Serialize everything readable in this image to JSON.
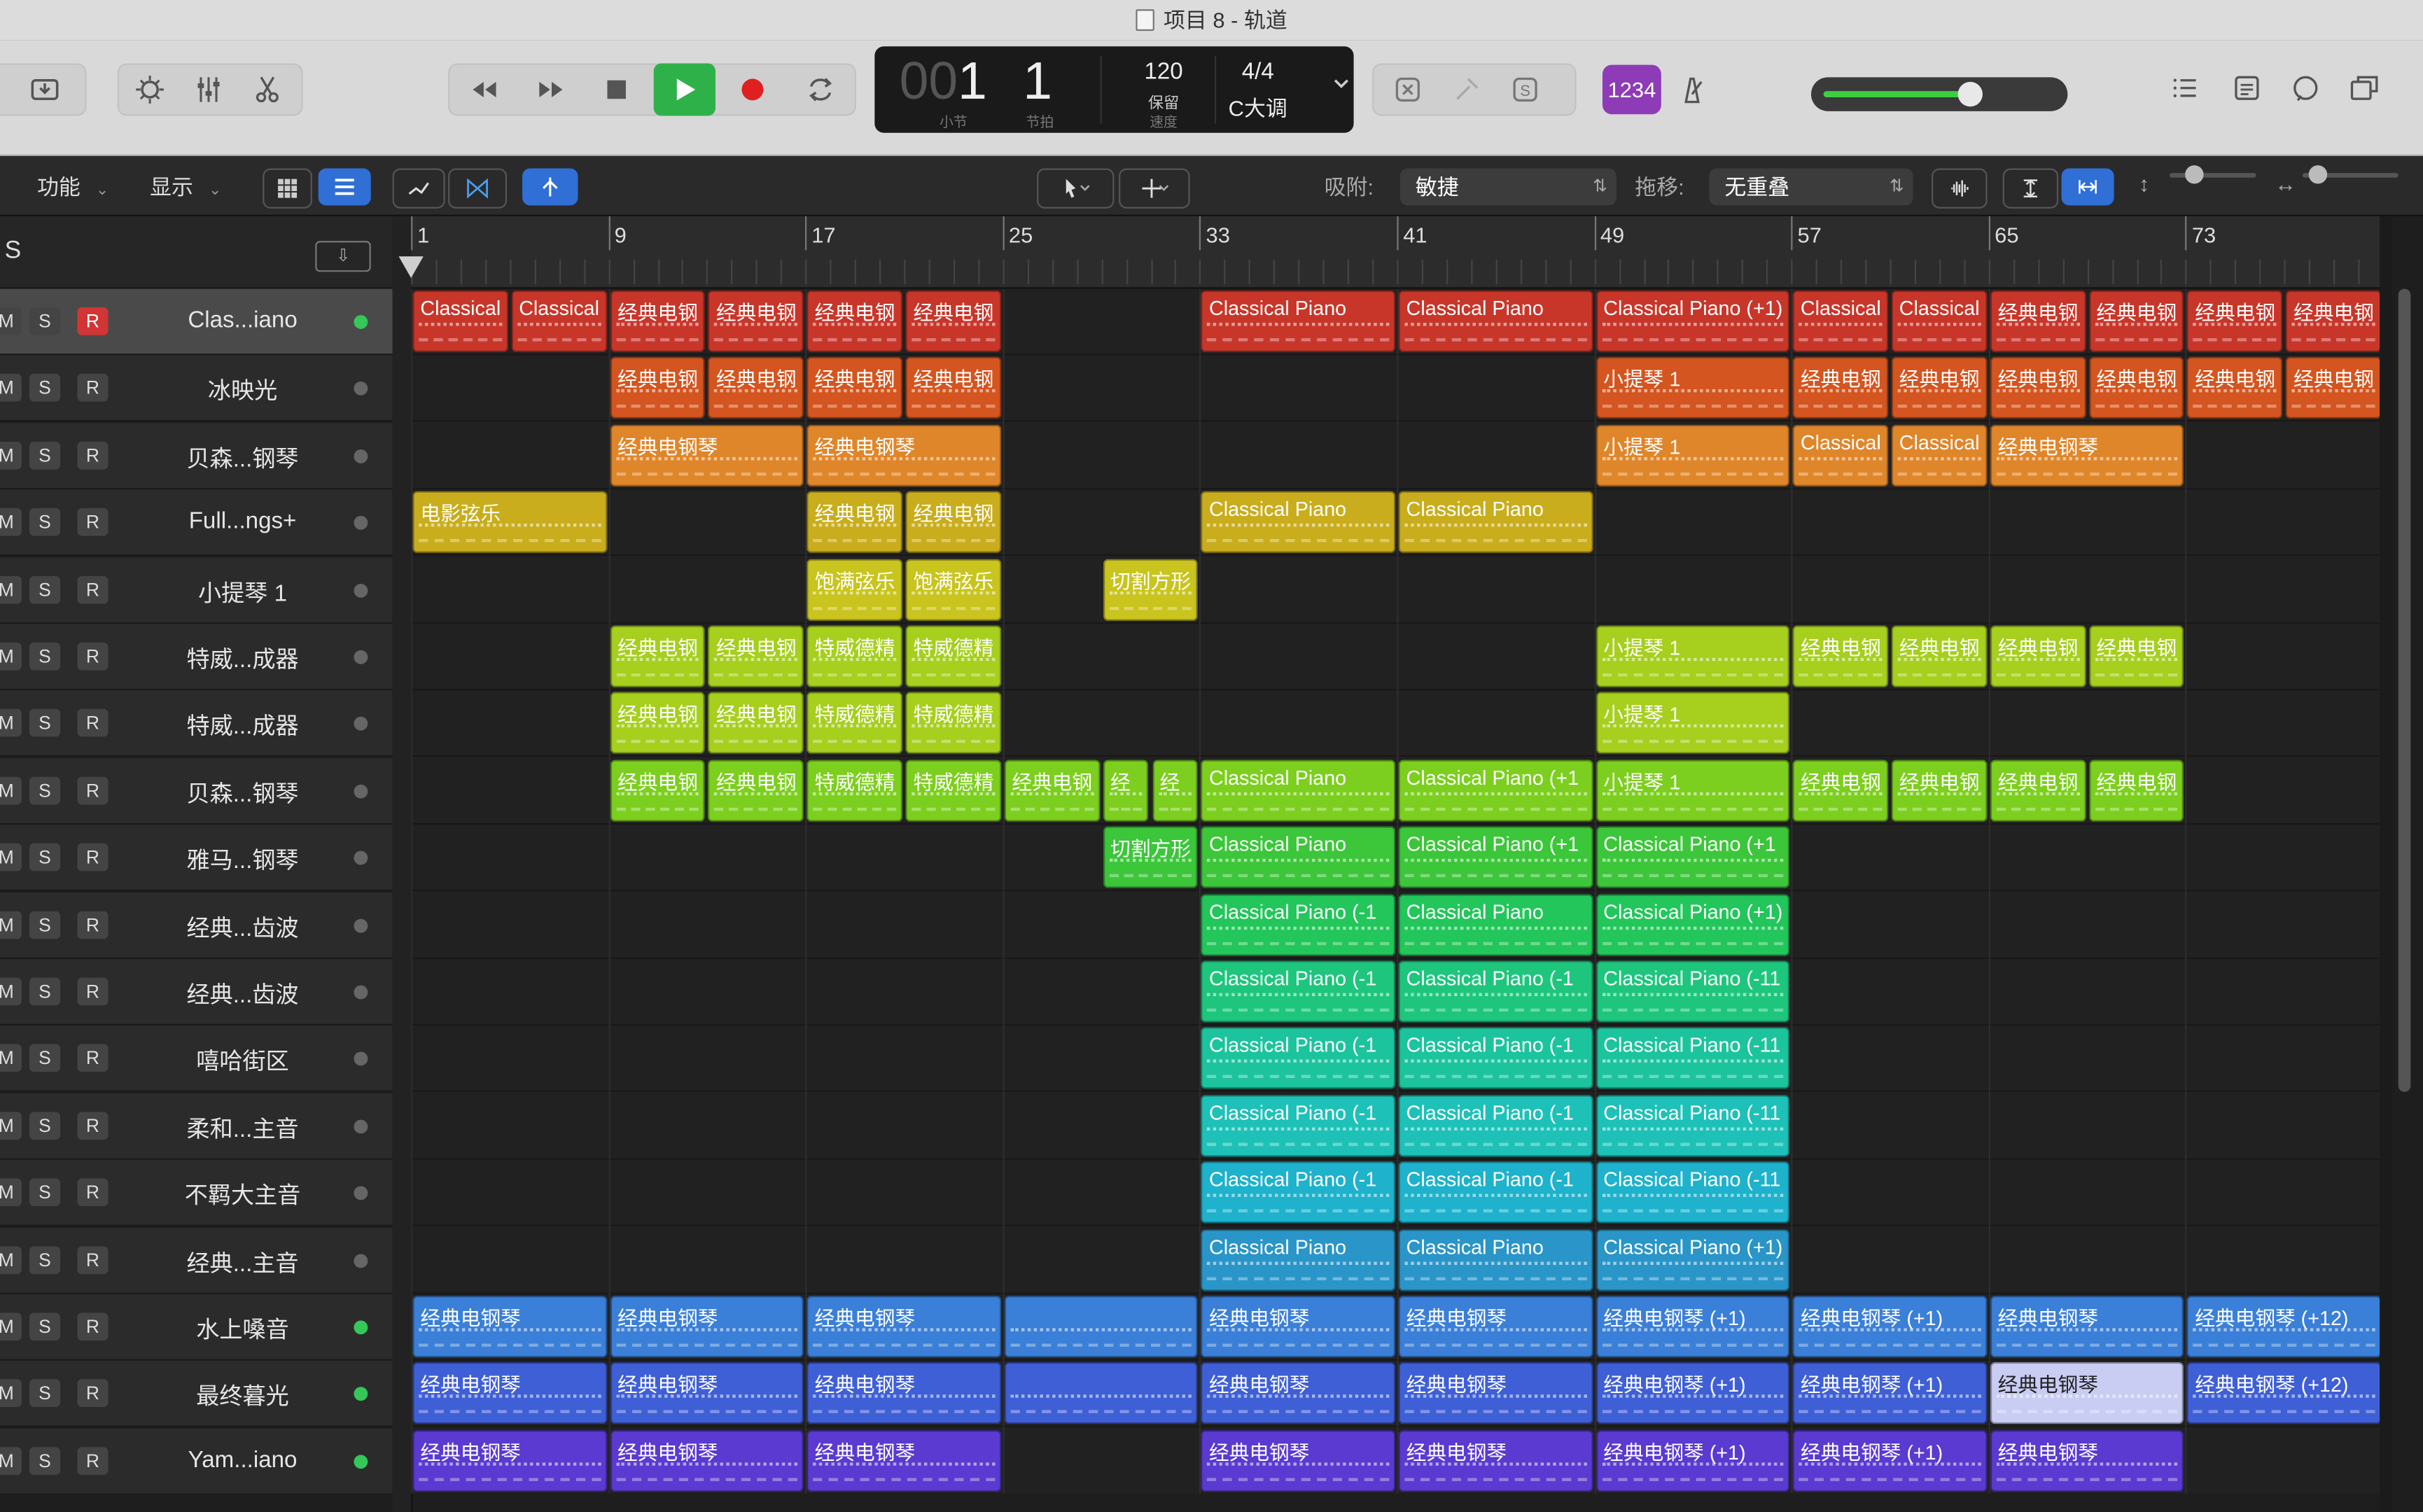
{
  "window": {
    "title": "项目 8 - 轨道"
  },
  "colors": {
    "accent_blue": "#2f6fd6",
    "play_green": "#2fb14a",
    "record_red": "#e02020",
    "count_in": "#8e3bb8"
  },
  "toolbar": {
    "left_icons": [
      "library-icon",
      "smart-controls-icon",
      "mixer-icon",
      "editor-icon"
    ],
    "transport": [
      "rewind-icon",
      "forward-icon",
      "stop-icon",
      "play-icon",
      "record-icon",
      "cycle-icon"
    ],
    "right_icons": [
      "list-editors-icon",
      "notes-icon",
      "loops-icon",
      "browser-icon"
    ]
  },
  "lcd": {
    "bar_dim": "00",
    "bar": "1",
    "beat": "1",
    "bar_label": "小节",
    "beat_label": "节拍",
    "tempo": "120",
    "tempo_mode": "保留",
    "tempo_label": "速度",
    "signature": "4/4",
    "key": "C大调"
  },
  "count_in": {
    "label": "1234"
  },
  "master_volume": {
    "level": 0.62
  },
  "subbar": {
    "menu_function": "功能",
    "menu_display": "显示",
    "snap_label": "吸附:",
    "snap_value": "敏捷",
    "drag_label": "拖移:",
    "drag_value": "无重叠"
  },
  "track_header": {
    "s_label": "S"
  },
  "tracks": [
    {
      "name": "Clas...iano",
      "armed": true,
      "led": true
    },
    {
      "name": "冰映光",
      "armed": false,
      "led": false
    },
    {
      "name": "贝森...钢琴",
      "armed": false,
      "led": false
    },
    {
      "name": "Full...ngs+",
      "armed": false,
      "led": false
    },
    {
      "name": "小提琴 1",
      "armed": false,
      "led": false
    },
    {
      "name": "特威...成器",
      "armed": false,
      "led": false
    },
    {
      "name": "特威...成器",
      "armed": false,
      "led": false
    },
    {
      "name": "贝森...钢琴",
      "armed": false,
      "led": false
    },
    {
      "name": "雅马...钢琴",
      "armed": false,
      "led": false
    },
    {
      "name": "经典...齿波",
      "armed": false,
      "led": false
    },
    {
      "name": "经典...齿波",
      "armed": false,
      "led": false
    },
    {
      "name": "嘻哈街区",
      "armed": false,
      "led": false
    },
    {
      "name": "柔和...主音",
      "armed": false,
      "led": false
    },
    {
      "name": "不羁大主音",
      "armed": false,
      "led": false
    },
    {
      "name": "经典...主音",
      "armed": false,
      "led": false
    },
    {
      "name": "水上嗓音",
      "armed": false,
      "led": true
    },
    {
      "name": "最终暮光",
      "armed": false,
      "led": true
    },
    {
      "name": "Yam...iano",
      "armed": false,
      "led": true
    }
  ],
  "track_buttons": {
    "mute": "M",
    "solo": "S",
    "rec": "R"
  },
  "ruler": {
    "bars": [
      "1",
      "9",
      "17",
      "25",
      "33",
      "41",
      "49",
      "57",
      "65",
      "73"
    ]
  },
  "regions": [
    {
      "track": 0,
      "start": 1,
      "end": 5,
      "label": "Classical",
      "color": "#c8362a"
    },
    {
      "track": 0,
      "start": 5,
      "end": 9,
      "label": "Classical",
      "color": "#c8362a"
    },
    {
      "track": 0,
      "start": 9,
      "end": 13,
      "label": "经典电钢",
      "color": "#c8362a"
    },
    {
      "track": 0,
      "start": 13,
      "end": 17,
      "label": "经典电钢",
      "color": "#c8362a"
    },
    {
      "track": 0,
      "start": 17,
      "end": 21,
      "label": "经典电钢",
      "color": "#c8362a"
    },
    {
      "track": 0,
      "start": 21,
      "end": 25,
      "label": "经典电钢",
      "color": "#c8362a"
    },
    {
      "track": 0,
      "start": 33,
      "end": 41,
      "label": "Classical Piano",
      "color": "#c8362a"
    },
    {
      "track": 0,
      "start": 41,
      "end": 49,
      "label": "Classical Piano",
      "color": "#c8362a"
    },
    {
      "track": 0,
      "start": 49,
      "end": 57,
      "label": "Classical Piano (+1)",
      "color": "#c8362a"
    },
    {
      "track": 0,
      "start": 57,
      "end": 61,
      "label": "Classical",
      "color": "#c8362a"
    },
    {
      "track": 0,
      "start": 61,
      "end": 65,
      "label": "Classical",
      "color": "#c8362a"
    },
    {
      "track": 0,
      "start": 65,
      "end": 69,
      "label": "经典电钢",
      "color": "#c8362a"
    },
    {
      "track": 0,
      "start": 69,
      "end": 73,
      "label": "经典电钢",
      "color": "#c8362a"
    },
    {
      "track": 0,
      "start": 73,
      "end": 77,
      "label": "经典电钢",
      "color": "#c8362a"
    },
    {
      "track": 0,
      "start": 77,
      "end": 81,
      "label": "经典电钢",
      "color": "#c8362a"
    },
    {
      "track": 1,
      "start": 9,
      "end": 13,
      "label": "经典电钢",
      "color": "#d4551f"
    },
    {
      "track": 1,
      "start": 13,
      "end": 17,
      "label": "经典电钢",
      "color": "#d4551f"
    },
    {
      "track": 1,
      "start": 17,
      "end": 21,
      "label": "经典电钢",
      "color": "#d4551f"
    },
    {
      "track": 1,
      "start": 21,
      "end": 25,
      "label": "经典电钢",
      "color": "#d4551f"
    },
    {
      "track": 1,
      "start": 49,
      "end": 57,
      "label": "小提琴 1",
      "color": "#d4551f"
    },
    {
      "track": 1,
      "start": 57,
      "end": 61,
      "label": "经典电钢",
      "color": "#d4551f"
    },
    {
      "track": 1,
      "start": 61,
      "end": 65,
      "label": "经典电钢",
      "color": "#d4551f"
    },
    {
      "track": 1,
      "start": 65,
      "end": 69,
      "label": "经典电钢",
      "color": "#d4551f"
    },
    {
      "track": 1,
      "start": 69,
      "end": 73,
      "label": "经典电钢",
      "color": "#d4551f"
    },
    {
      "track": 1,
      "start": 73,
      "end": 77,
      "label": "经典电钢",
      "color": "#d4551f"
    },
    {
      "track": 1,
      "start": 77,
      "end": 81,
      "label": "经典电钢",
      "color": "#d4551f"
    },
    {
      "track": 2,
      "start": 9,
      "end": 17,
      "label": "经典电钢琴",
      "color": "#e0862a"
    },
    {
      "track": 2,
      "start": 17,
      "end": 25,
      "label": "经典电钢琴",
      "color": "#e0862a"
    },
    {
      "track": 2,
      "start": 49,
      "end": 57,
      "label": "小提琴 1",
      "color": "#e0862a"
    },
    {
      "track": 2,
      "start": 57,
      "end": 61,
      "label": "Classical",
      "color": "#e0862a"
    },
    {
      "track": 2,
      "start": 61,
      "end": 65,
      "label": "Classical",
      "color": "#e0862a"
    },
    {
      "track": 2,
      "start": 65,
      "end": 73,
      "label": "经典电钢琴",
      "color": "#e0862a"
    },
    {
      "track": 3,
      "start": 1,
      "end": 9,
      "label": "电影弦乐",
      "color": "#c9ad1c"
    },
    {
      "track": 3,
      "start": 17,
      "end": 21,
      "label": "经典电钢",
      "color": "#c9ad1c"
    },
    {
      "track": 3,
      "start": 21,
      "end": 25,
      "label": "经典电钢",
      "color": "#c9ad1c"
    },
    {
      "track": 3,
      "start": 33,
      "end": 41,
      "label": "Classical Piano",
      "color": "#c9ad1c"
    },
    {
      "track": 3,
      "start": 41,
      "end": 49,
      "label": "Classical Piano",
      "color": "#c9ad1c"
    },
    {
      "track": 4,
      "start": 17,
      "end": 21,
      "label": "饱满弦乐",
      "color": "#c9c41e"
    },
    {
      "track": 4,
      "start": 21,
      "end": 25,
      "label": "饱满弦乐",
      "color": "#c9c41e"
    },
    {
      "track": 4,
      "start": 29,
      "end": 33,
      "label": "切割方形",
      "color": "#c9c41e"
    },
    {
      "track": 5,
      "start": 9,
      "end": 13,
      "label": "经典电钢",
      "color": "#a6cf1e"
    },
    {
      "track": 5,
      "start": 13,
      "end": 17,
      "label": "经典电钢",
      "color": "#a6cf1e"
    },
    {
      "track": 5,
      "start": 17,
      "end": 21,
      "label": "特威德精",
      "color": "#a6cf1e"
    },
    {
      "track": 5,
      "start": 21,
      "end": 25,
      "label": "特威德精",
      "color": "#a6cf1e"
    },
    {
      "track": 5,
      "start": 49,
      "end": 57,
      "label": "小提琴 1",
      "color": "#a6cf1e"
    },
    {
      "track": 5,
      "start": 57,
      "end": 61,
      "label": "经典电钢",
      "color": "#a6cf1e"
    },
    {
      "track": 5,
      "start": 61,
      "end": 65,
      "label": "经典电钢",
      "color": "#a6cf1e"
    },
    {
      "track": 5,
      "start": 65,
      "end": 69,
      "label": "经典电钢",
      "color": "#a6cf1e"
    },
    {
      "track": 5,
      "start": 69,
      "end": 73,
      "label": "经典电钢",
      "color": "#a6cf1e"
    },
    {
      "track": 6,
      "start": 9,
      "end": 13,
      "label": "经典电钢",
      "color": "#a6cf1e"
    },
    {
      "track": 6,
      "start": 13,
      "end": 17,
      "label": "经典电钢",
      "color": "#a6cf1e"
    },
    {
      "track": 6,
      "start": 17,
      "end": 21,
      "label": "特威德精",
      "color": "#a6cf1e"
    },
    {
      "track": 6,
      "start": 21,
      "end": 25,
      "label": "特威德精",
      "color": "#a6cf1e"
    },
    {
      "track": 6,
      "start": 49,
      "end": 57,
      "label": "小提琴 1",
      "color": "#a6cf1e"
    },
    {
      "track": 7,
      "start": 9,
      "end": 13,
      "label": "经典电钢",
      "color": "#7ccf1e"
    },
    {
      "track": 7,
      "start": 13,
      "end": 17,
      "label": "经典电钢",
      "color": "#7ccf1e"
    },
    {
      "track": 7,
      "start": 17,
      "end": 21,
      "label": "特威德精",
      "color": "#7ccf1e"
    },
    {
      "track": 7,
      "start": 21,
      "end": 25,
      "label": "特威德精",
      "color": "#7ccf1e"
    },
    {
      "track": 7,
      "start": 25,
      "end": 29,
      "label": "经典电钢",
      "color": "#7ccf1e"
    },
    {
      "track": 7,
      "start": 29,
      "end": 31,
      "label": "经",
      "color": "#7ccf1e"
    },
    {
      "track": 7,
      "start": 31,
      "end": 33,
      "label": "经",
      "color": "#7ccf1e"
    },
    {
      "track": 7,
      "start": 33,
      "end": 41,
      "label": "Classical Piano",
      "color": "#7ccf1e"
    },
    {
      "track": 7,
      "start": 41,
      "end": 49,
      "label": "Classical Piano (+1",
      "color": "#7ccf1e"
    },
    {
      "track": 7,
      "start": 49,
      "end": 57,
      "label": "小提琴 1",
      "color": "#7ccf1e"
    },
    {
      "track": 7,
      "start": 57,
      "end": 61,
      "label": "经典电钢",
      "color": "#7ccf1e"
    },
    {
      "track": 7,
      "start": 61,
      "end": 65,
      "label": "经典电钢",
      "color": "#7ccf1e"
    },
    {
      "track": 7,
      "start": 65,
      "end": 69,
      "label": "经典电钢",
      "color": "#7ccf1e"
    },
    {
      "track": 7,
      "start": 69,
      "end": 73,
      "label": "经典电钢",
      "color": "#7ccf1e"
    },
    {
      "track": 8,
      "start": 29,
      "end": 33,
      "label": "切割方形",
      "color": "#3cc63a"
    },
    {
      "track": 8,
      "start": 33,
      "end": 41,
      "label": "Classical Piano",
      "color": "#3cc63a"
    },
    {
      "track": 8,
      "start": 41,
      "end": 49,
      "label": "Classical Piano (+1",
      "color": "#3cc63a"
    },
    {
      "track": 8,
      "start": 49,
      "end": 57,
      "label": "Classical Piano (+1",
      "color": "#3cc63a"
    },
    {
      "track": 9,
      "start": 33,
      "end": 41,
      "label": "Classical Piano (-1",
      "color": "#22c65a"
    },
    {
      "track": 9,
      "start": 41,
      "end": 49,
      "label": "Classical Piano",
      "color": "#22c65a"
    },
    {
      "track": 9,
      "start": 49,
      "end": 57,
      "label": "Classical Piano (+1)",
      "color": "#22c65a"
    },
    {
      "track": 10,
      "start": 33,
      "end": 41,
      "label": "Classical Piano (-1",
      "color": "#1dc67c"
    },
    {
      "track": 10,
      "start": 41,
      "end": 49,
      "label": "Classical Piano (-1",
      "color": "#1dc67c"
    },
    {
      "track": 10,
      "start": 49,
      "end": 57,
      "label": "Classical Piano (-11",
      "color": "#1dc67c"
    },
    {
      "track": 11,
      "start": 33,
      "end": 41,
      "label": "Classical Piano (-1",
      "color": "#1cc49d"
    },
    {
      "track": 11,
      "start": 41,
      "end": 49,
      "label": "Classical Piano (-1",
      "color": "#1cc49d"
    },
    {
      "track": 11,
      "start": 49,
      "end": 57,
      "label": "Classical Piano (-11",
      "color": "#1cc49d"
    },
    {
      "track": 12,
      "start": 33,
      "end": 41,
      "label": "Classical Piano (-1",
      "color": "#1ec1b8"
    },
    {
      "track": 12,
      "start": 41,
      "end": 49,
      "label": "Classical Piano (-1",
      "color": "#1ec1b8"
    },
    {
      "track": 12,
      "start": 49,
      "end": 57,
      "label": "Classical Piano (-11",
      "color": "#1ec1b8"
    },
    {
      "track": 13,
      "start": 33,
      "end": 41,
      "label": "Classical Piano (-1",
      "color": "#1eb2cc"
    },
    {
      "track": 13,
      "start": 41,
      "end": 49,
      "label": "Classical Piano (-1",
      "color": "#1eb2cc"
    },
    {
      "track": 13,
      "start": 49,
      "end": 57,
      "label": "Classical Piano (-11",
      "color": "#1eb2cc"
    },
    {
      "track": 14,
      "start": 33,
      "end": 41,
      "label": "Classical Piano",
      "color": "#2a95c8"
    },
    {
      "track": 14,
      "start": 41,
      "end": 49,
      "label": "Classical Piano",
      "color": "#2a95c8"
    },
    {
      "track": 14,
      "start": 49,
      "end": 57,
      "label": "Classical Piano (+1)",
      "color": "#2a95c8"
    },
    {
      "track": 15,
      "start": 1,
      "end": 9,
      "label": "经典电钢琴",
      "color": "#3a7fd8"
    },
    {
      "track": 15,
      "start": 9,
      "end": 17,
      "label": "经典电钢琴",
      "color": "#3a7fd8"
    },
    {
      "track": 15,
      "start": 17,
      "end": 25,
      "label": "经典电钢琴",
      "color": "#3a7fd8"
    },
    {
      "track": 15,
      "start": 25,
      "end": 33,
      "label": "",
      "color": "#3a7fd8"
    },
    {
      "track": 15,
      "start": 33,
      "end": 41,
      "label": "经典电钢琴",
      "color": "#3a7fd8"
    },
    {
      "track": 15,
      "start": 41,
      "end": 49,
      "label": "经典电钢琴",
      "color": "#3a7fd8"
    },
    {
      "track": 15,
      "start": 49,
      "end": 57,
      "label": "经典电钢琴 (+1)",
      "color": "#3a7fd8"
    },
    {
      "track": 15,
      "start": 57,
      "end": 65,
      "label": "经典电钢琴 (+1)",
      "color": "#3a7fd8"
    },
    {
      "track": 15,
      "start": 65,
      "end": 73,
      "label": "经典电钢琴",
      "color": "#3a7fd8"
    },
    {
      "track": 15,
      "start": 73,
      "end": 81,
      "label": "经典电钢琴 (+12)",
      "color": "#3a7fd8"
    },
    {
      "track": 16,
      "start": 1,
      "end": 9,
      "label": "经典电钢琴",
      "color": "#3f5fd6"
    },
    {
      "track": 16,
      "start": 9,
      "end": 17,
      "label": "经典电钢琴",
      "color": "#3f5fd6"
    },
    {
      "track": 16,
      "start": 17,
      "end": 25,
      "label": "经典电钢琴",
      "color": "#3f5fd6"
    },
    {
      "track": 16,
      "start": 25,
      "end": 33,
      "label": "",
      "color": "#3f5fd6"
    },
    {
      "track": 16,
      "start": 33,
      "end": 41,
      "label": "经典电钢琴",
      "color": "#3f5fd6"
    },
    {
      "track": 16,
      "start": 41,
      "end": 49,
      "label": "经典电钢琴",
      "color": "#3f5fd6"
    },
    {
      "track": 16,
      "start": 49,
      "end": 57,
      "label": "经典电钢琴 (+1)",
      "color": "#3f5fd6"
    },
    {
      "track": 16,
      "start": 57,
      "end": 65,
      "label": "经典电钢琴 (+1)",
      "color": "#3f5fd6"
    },
    {
      "track": 16,
      "start": 65,
      "end": 73,
      "label": "经典电钢琴",
      "color": "#c9cdf4",
      "light": true
    },
    {
      "track": 16,
      "start": 73,
      "end": 81,
      "label": "经典电钢琴 (+12)",
      "color": "#3f5fd6"
    },
    {
      "track": 17,
      "start": 1,
      "end": 9,
      "label": "经典电钢琴",
      "color": "#5a3ad0"
    },
    {
      "track": 17,
      "start": 9,
      "end": 17,
      "label": "经典电钢琴",
      "color": "#5a3ad0"
    },
    {
      "track": 17,
      "start": 17,
      "end": 25,
      "label": "经典电钢琴",
      "color": "#5a3ad0"
    },
    {
      "track": 17,
      "start": 33,
      "end": 41,
      "label": "经典电钢琴",
      "color": "#5a3ad0"
    },
    {
      "track": 17,
      "start": 41,
      "end": 49,
      "label": "经典电钢琴",
      "color": "#5a3ad0"
    },
    {
      "track": 17,
      "start": 49,
      "end": 57,
      "label": "经典电钢琴 (+1)",
      "color": "#5a3ad0"
    },
    {
      "track": 17,
      "start": 57,
      "end": 65,
      "label": "经典电钢琴 (+1)",
      "color": "#5a3ad0"
    },
    {
      "track": 17,
      "start": 65,
      "end": 73,
      "label": "经典电钢琴",
      "color": "#5a3ad0"
    }
  ]
}
